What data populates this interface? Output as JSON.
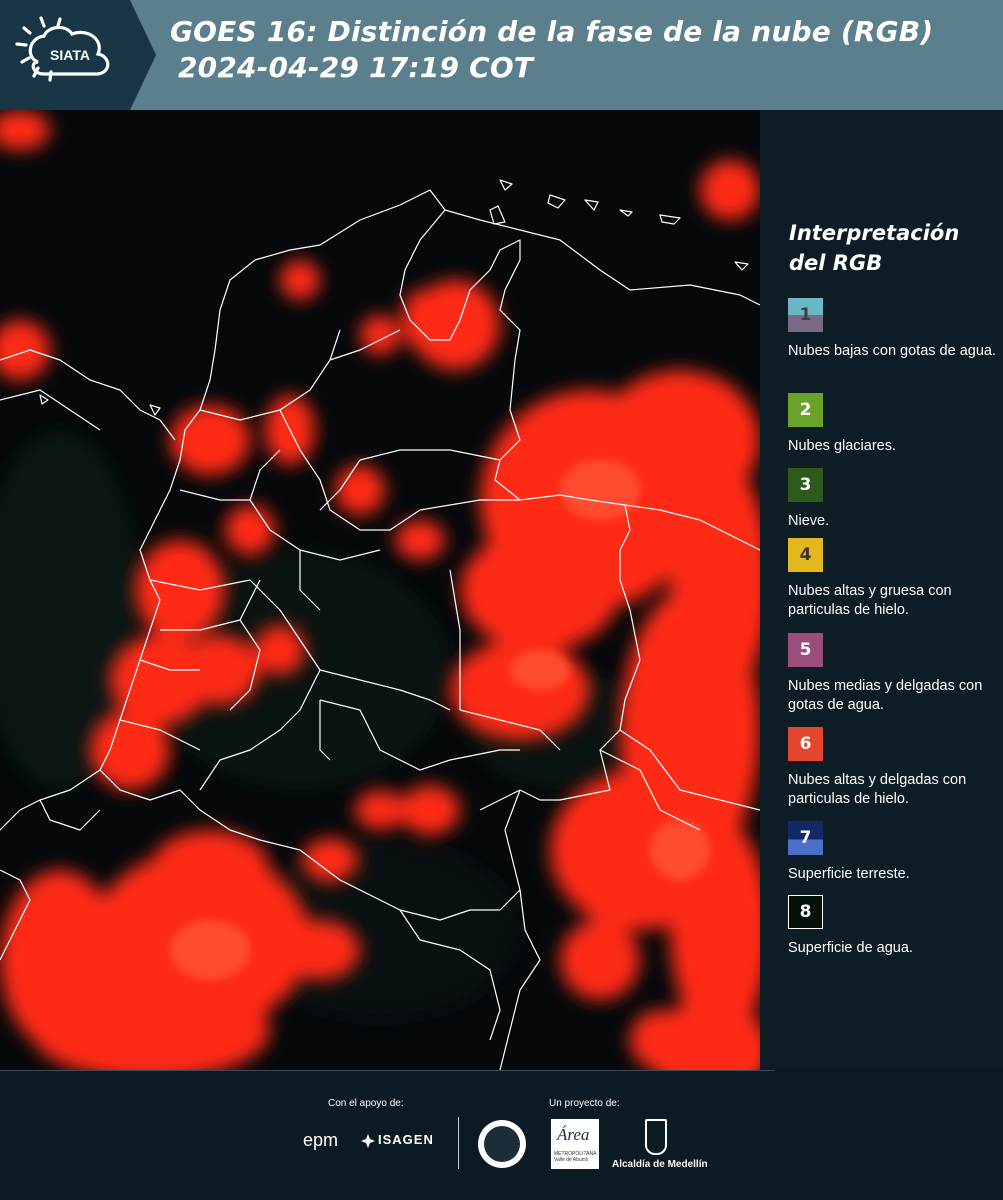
{
  "header": {
    "logo_text": "SIATA",
    "title_line1": "GOES 16: Distinción de la fase de la nube (RGB)",
    "title_line2": "2024-04-29 17:19 COT"
  },
  "legend": {
    "title": "Interpretación del RGB",
    "items": [
      {
        "number": "1",
        "label": "Nubes bajas con gotas de agua.",
        "color_top": "#6bb7c4",
        "color_bottom": "#7b6a86",
        "text_color": "#3d3d46"
      },
      {
        "number": "2",
        "label": "Nubes glaciares.",
        "color_top": "#6aa329",
        "color_bottom": "#6aa329",
        "text_color": "#ffffff"
      },
      {
        "number": "3",
        "label": "Nieve.",
        "color_top": "#2e5a1c",
        "color_bottom": "#2e5a1c",
        "text_color": "#ffffff"
      },
      {
        "number": "4",
        "label": "Nubes altas y gruesa con particulas de hielo.",
        "color_top": "#e3b71e",
        "color_bottom": "#e3b71e",
        "text_color": "#3d3524"
      },
      {
        "number": "5",
        "label": "Nubes medias y delgadas con gotas de agua.",
        "color_top": "#9c4c7a",
        "color_bottom": "#9c4c7a",
        "text_color": "#ffffff"
      },
      {
        "number": "6",
        "label": "Nubes altas y delgadas con particulas de hielo.",
        "color_top": "#e2472d",
        "color_bottom": "#e2472d",
        "text_color": "#ffffff"
      },
      {
        "number": "7",
        "label": "Superficie terreste.",
        "color_top": "#132866",
        "color_bottom": "#4b6fc8",
        "text_color": "#ffffff"
      },
      {
        "number": "8",
        "label": "Superficie de agua.",
        "color_top": "#06110a",
        "color_bottom": "#06110a",
        "text_color": "#ffffff"
      }
    ]
  },
  "footer": {
    "support_label": "Con el apoyo de:",
    "project_label": "Un proyecto de:",
    "sponsor_epm": "epm",
    "sponsor_isagen": "ISAGEN",
    "area_logo_text": "Área",
    "area_logo_subtext": "METROPOLITANA Valle de Aburrá",
    "medellin_label": "Alcaldía de Medellín"
  },
  "map": {
    "background_color": "#05090c",
    "cloud_color": "#ff2a18",
    "boundary_color": "#ffffff"
  }
}
